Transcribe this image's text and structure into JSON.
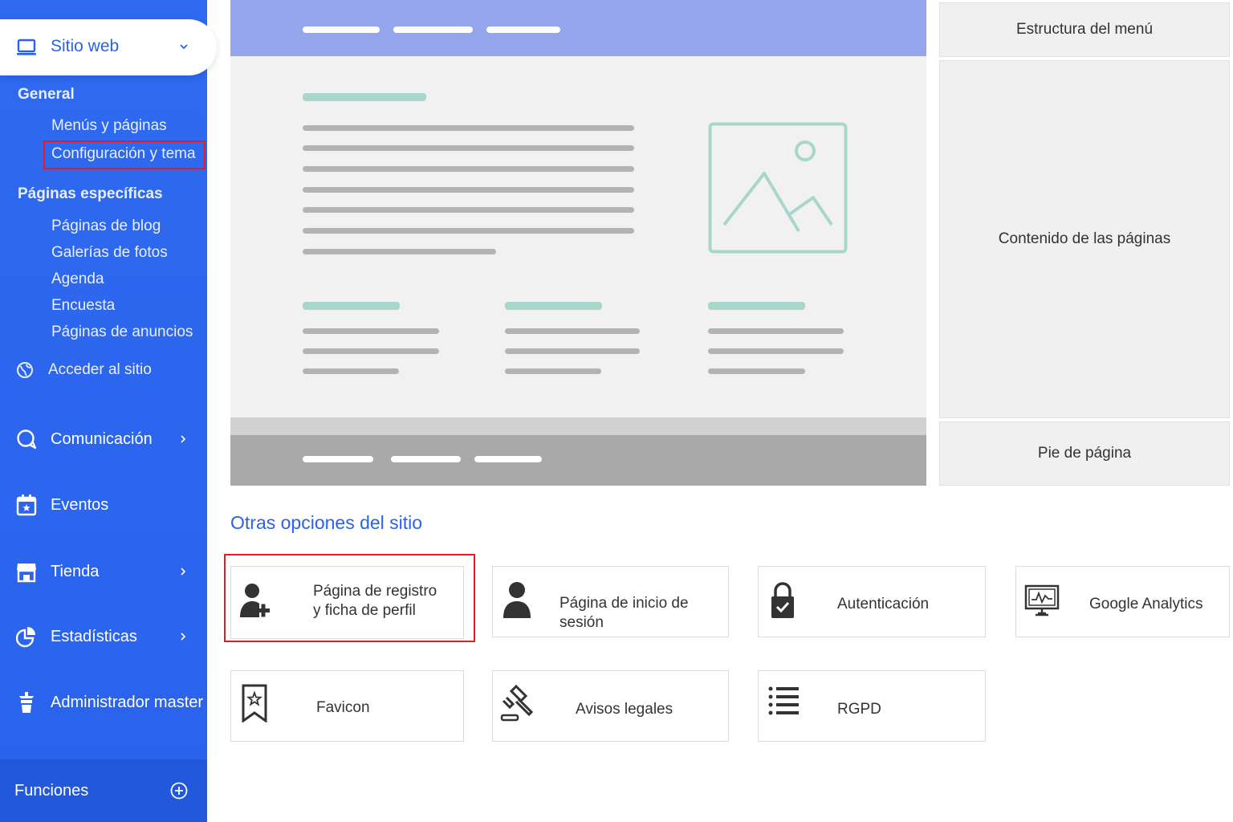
{
  "sidebar": {
    "site_selector": {
      "label": "Sitio web",
      "icon": "laptop-icon"
    },
    "general": {
      "heading": "General",
      "items": [
        {
          "label": "Menús y páginas"
        },
        {
          "label": "Configuración y tema",
          "highlighted": true
        }
      ]
    },
    "specific": {
      "heading": "Páginas específicas",
      "items": [
        {
          "label": "Páginas de blog"
        },
        {
          "label": "Galerías de fotos"
        },
        {
          "label": "Agenda"
        },
        {
          "label": "Encuesta"
        },
        {
          "label": "Páginas de anuncios"
        }
      ]
    },
    "access": {
      "label": "Acceder al sitio",
      "icon": "globe-icon"
    },
    "nav": [
      {
        "label": "Comunicación",
        "icon": "chat-icon",
        "has_submenu": true
      },
      {
        "label": "Eventos",
        "icon": "calendar-icon",
        "has_submenu": false
      },
      {
        "label": "Tienda",
        "icon": "store-icon",
        "has_submenu": true
      },
      {
        "label": "Estadísticas",
        "icon": "pie-chart-icon",
        "has_submenu": true
      },
      {
        "label": "Administrador master",
        "icon": "admin-icon",
        "has_submenu": false
      }
    ],
    "footer": {
      "label": "Funciones",
      "icon": "plus-circle-icon"
    }
  },
  "layout_panels": {
    "menu_structure": "Estructura del menú",
    "page_content": "Contenido de las páginas",
    "footer": "Pie de página"
  },
  "options": {
    "title": "Otras opciones del sitio",
    "cards": [
      {
        "label_line1": "Página de registro",
        "label_line2": "y ficha de perfil",
        "icon": "add-user-icon",
        "highlighted": true
      },
      {
        "label": "Página de inicio de sesión",
        "icon": "user-icon"
      },
      {
        "label": "Autenticación",
        "icon": "lock-icon"
      },
      {
        "label": "Google Analytics",
        "icon": "monitor-chart-icon"
      },
      {
        "label": "Favicon",
        "icon": "bookmark-star-icon"
      },
      {
        "label": "Avisos legales",
        "icon": "gavel-icon"
      },
      {
        "label": "RGPD",
        "icon": "list-icon"
      }
    ]
  },
  "colors": {
    "sidebar_bg": "#2a62ec",
    "accent": "#2a62ec",
    "highlight_border": "#e51b24",
    "preview_header": "#94a5ec",
    "preview_footer": "#a8a8a8",
    "mock_teal": "#a8d6cb"
  }
}
